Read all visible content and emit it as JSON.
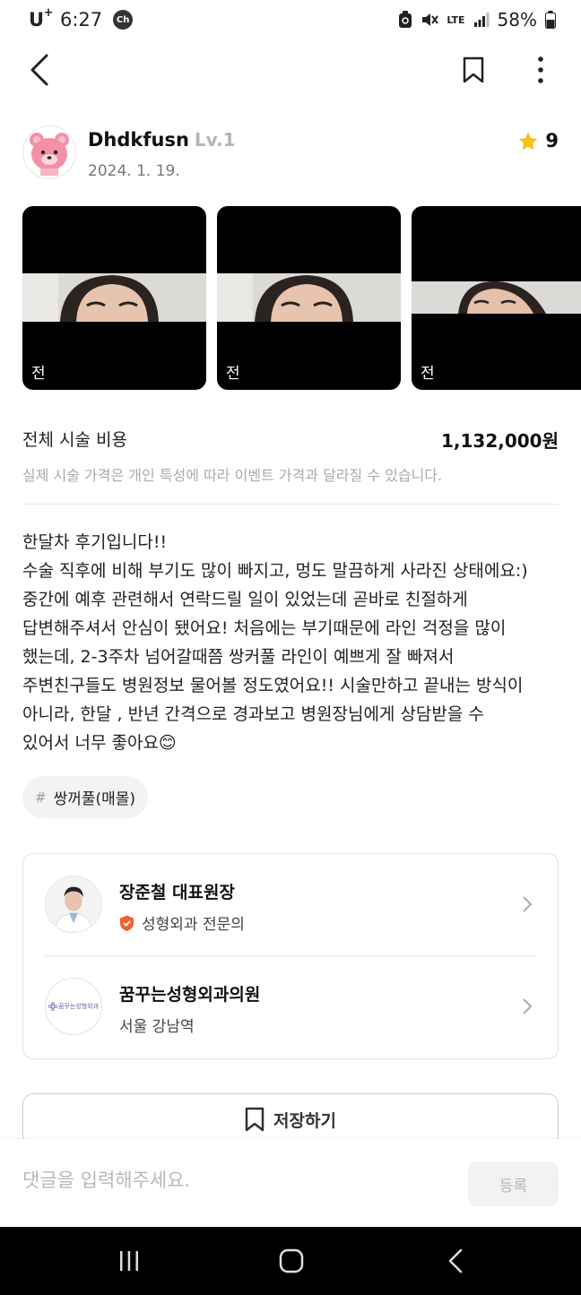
{
  "status_bar": {
    "carrier": "U",
    "carrier_sup": "+",
    "time": "6:27",
    "ch_badge": "Ch",
    "network": "LTE",
    "battery": "58%"
  },
  "author": {
    "name": "Dhdkfusn",
    "level": "Lv.1",
    "date": "2024. 1. 19.",
    "rating": "9"
  },
  "photos": [
    {
      "label": "전"
    },
    {
      "label": "전"
    },
    {
      "label": "전"
    }
  ],
  "cost": {
    "title": "전체 시술 비용",
    "value": "1,132,000원",
    "note": "실제 시술 가격은 개인 특성에 따라 이벤트 가격과 달라질 수 있습니다."
  },
  "review": {
    "lines": [
      "한달차 후기입니다!!",
      "수술 직후에 비해 부기도 많이 빠지고, 멍도 말끔하게 사라진 상태에요:)",
      "중간에 예후 관련해서 연락드릴 일이 있었는데 곧바로 친절하게",
      "답변해주셔서 안심이 됐어요! 처음에는 부기때문에 라인 걱정을 많이",
      "했는데, 2-3주차 넘어갈때쯤 쌍커풀 라인이 예쁘게 잘 빠져서",
      "주변친구들도 병원정보 물어볼 정도였어요!! 시술만하고 끝내는 방식이",
      "아니라, 한달 , 반년 간격으로 경과보고 병원장님에게 상담받을 수",
      "있어서 너무 좋아요😊"
    ]
  },
  "tag": {
    "hash": "#",
    "text": "쌍꺼풀(매몰)"
  },
  "doctor": {
    "name": "장준철 대표원장",
    "specialty": "성형외과 전문의"
  },
  "clinic": {
    "name": "꿈꾸는성형외과의원",
    "location": "서울 강남역",
    "logo_text": "꿈꾸는성형외과"
  },
  "save_button": {
    "label": "저장하기"
  },
  "comment": {
    "placeholder": "댓글을 입력해주세요.",
    "submit_label": "등록"
  },
  "colors": {
    "star": "#f7c11b",
    "badge": "#f0612d",
    "text_muted": "#aaaaaa"
  }
}
